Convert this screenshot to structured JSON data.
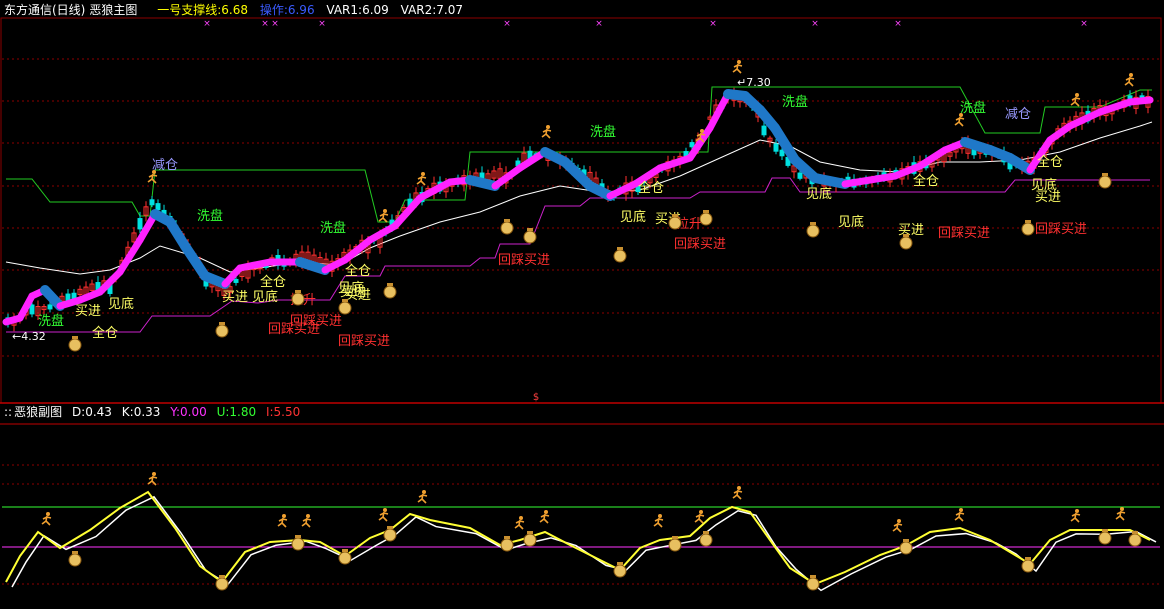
{
  "main_header": {
    "stock": "东方通信(日线)",
    "indicator": "恶狼主图",
    "support_label": "一号支撑线:6.68",
    "operate_label": "操作:6.96",
    "var1_label": "VAR1:6.09",
    "var2_label": "VAR2:7.07"
  },
  "sub_header": {
    "prefix": "::",
    "indicator": "恶狼副图",
    "d_label": "D:0.43",
    "k_label": "K:0.33",
    "y_label": "Y:0.00",
    "u_label": "U:1.80",
    "i_label": "I:5.50"
  },
  "colors": {
    "background": "#000000",
    "grid": "#8b0000",
    "support": "#ffff00",
    "operate": "#3a5bff",
    "var": "#ffffff",
    "y": "#ff33ff",
    "u": "#33ff33",
    "i": "#ff3333",
    "ribbon_up": "#ff22ff",
    "ribbon_down": "#1f78c8",
    "upper_line": "#22cc22",
    "lower_line": "#cc22cc",
    "ma_line": "#ffffff",
    "label_green": "#33ff33",
    "label_yellow": "#ffff66",
    "label_red": "#ff3030",
    "label_blue": "#9999ff"
  },
  "chart_data": [
    {
      "type": "candlestick",
      "title": "恶狼主图",
      "price_annotations": {
        "high": "7.30",
        "low": "4.32"
      },
      "signal_labels": [
        {
          "text": "减仓",
          "color": "label_blue"
        },
        {
          "text": "洗盘",
          "color": "label_green"
        },
        {
          "text": "洗盘",
          "color": "label_green"
        },
        {
          "text": "洗盘",
          "color": "label_green"
        },
        {
          "text": "洗盘",
          "color": "label_green"
        },
        {
          "text": "洗盘",
          "color": "label_green"
        },
        {
          "text": "减仓",
          "color": "label_blue"
        },
        {
          "text": "洗盘",
          "color": "label_green"
        },
        {
          "text": "买进",
          "color": "label_yellow"
        },
        {
          "text": "见底",
          "color": "label_yellow"
        },
        {
          "text": "全仓",
          "color": "label_yellow"
        },
        {
          "text": "买进",
          "color": "label_yellow"
        },
        {
          "text": "见底",
          "color": "label_yellow"
        },
        {
          "text": "买进",
          "color": "label_yellow"
        },
        {
          "text": "全仓",
          "color": "label_yellow"
        },
        {
          "text": "拉升",
          "color": "label_red"
        },
        {
          "text": "回踩买进",
          "color": "label_red"
        },
        {
          "text": "回踩买进",
          "color": "label_red"
        },
        {
          "text": "全仓",
          "color": "label_yellow"
        },
        {
          "text": "见底",
          "color": "label_yellow"
        },
        {
          "text": "买进",
          "color": "label_yellow"
        },
        {
          "text": "回踩买进",
          "color": "label_red"
        },
        {
          "text": "回踩买进",
          "color": "label_red"
        },
        {
          "text": "全仓",
          "color": "label_yellow"
        },
        {
          "text": "见底",
          "color": "label_yellow"
        },
        {
          "text": "买进",
          "color": "label_yellow"
        },
        {
          "text": "拉升",
          "color": "label_red"
        },
        {
          "text": "回踩买进",
          "color": "label_red"
        },
        {
          "text": "见底",
          "color": "label_yellow"
        },
        {
          "text": "见底",
          "color": "label_yellow"
        },
        {
          "text": "买进",
          "color": "label_yellow"
        },
        {
          "text": "全仓",
          "color": "label_yellow"
        },
        {
          "text": "回踩买进",
          "color": "label_red"
        },
        {
          "text": "全仓",
          "color": "label_yellow"
        },
        {
          "text": "见底",
          "color": "label_yellow"
        },
        {
          "text": "买进",
          "color": "label_yellow"
        },
        {
          "text": "回踩买进",
          "color": "label_red"
        }
      ]
    },
    {
      "type": "line",
      "title": "恶狼副图",
      "series": [
        {
          "name": "D",
          "value": 0.43,
          "color": "support"
        },
        {
          "name": "K",
          "value": 0.33,
          "color": "var"
        },
        {
          "name": "Y",
          "value": 0.0,
          "color": "y"
        },
        {
          "name": "U",
          "value": 1.8,
          "color": "u"
        },
        {
          "name": "I",
          "value": 5.5,
          "color": "i"
        }
      ]
    }
  ]
}
